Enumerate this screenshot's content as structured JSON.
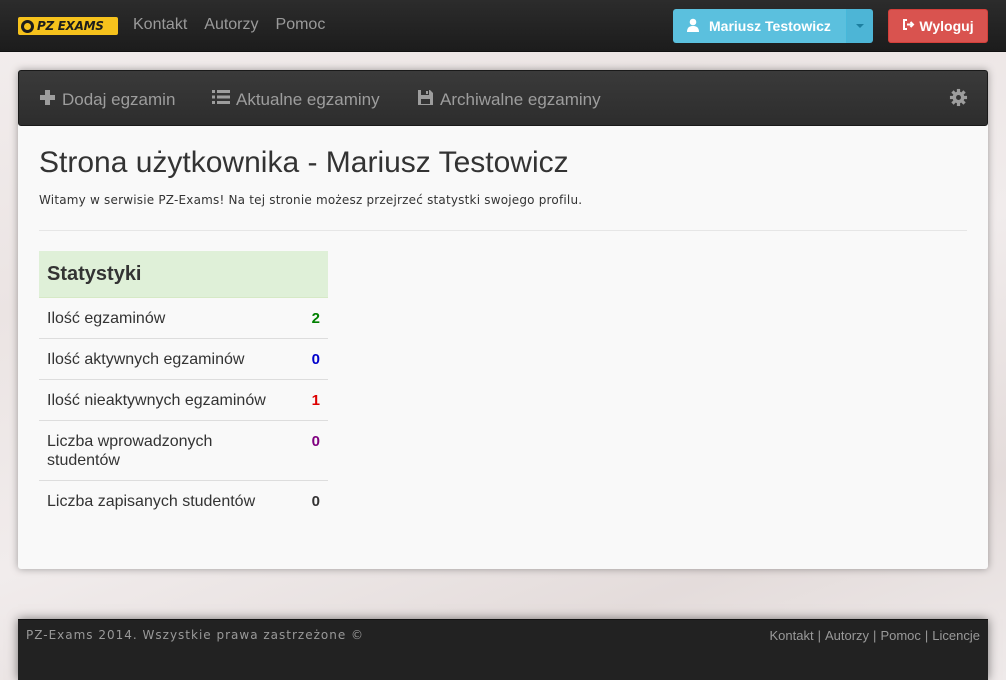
{
  "topbar": {
    "brand": "PZ EXAMS",
    "nav": [
      "Kontakt",
      "Autorzy",
      "Pomoc"
    ],
    "user_label": "Mariusz Testowicz",
    "logout_label": "Wyloguj"
  },
  "subnav": {
    "add_exam": "Dodaj egzamin",
    "current_exams": "Aktualne egzaminy",
    "archived_exams": "Archiwalne egzaminy"
  },
  "page": {
    "title": "Strona użytkownika - Mariusz Testowicz",
    "welcome": "Witamy w serwisie PZ-Exams! Na tej stronie możesz przejrzeć statystki swojego profilu."
  },
  "stats": {
    "heading": "Statystyki",
    "rows": [
      {
        "label": "Ilość egzaminów",
        "value": "2",
        "color": "#008000"
      },
      {
        "label": "Ilość aktywnych egzaminów",
        "value": "0",
        "color": "#0000cc"
      },
      {
        "label": "Ilość nieaktywnych egzaminów",
        "value": "1",
        "color": "#dd0000"
      },
      {
        "label": "Liczba wprowadzonych studentów",
        "value": "0",
        "color": "#800080"
      },
      {
        "label": "Liczba zapisanych studentów",
        "value": "0",
        "color": "#333333"
      }
    ]
  },
  "footer": {
    "copyright": "PZ-Exams 2014. Wszystkie prawa zastrzeżone ©",
    "links": [
      "Kontakt",
      "Autorzy",
      "Pomoc",
      "Licencje"
    ]
  }
}
